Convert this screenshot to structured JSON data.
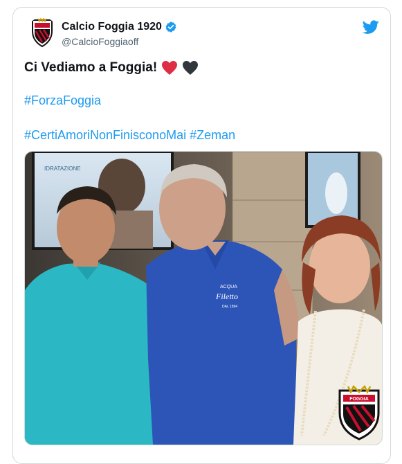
{
  "account": {
    "display_name": "Calcio Foggia 1920",
    "handle": "@CalcioFoggiaoff",
    "verified": true,
    "avatar_icon": "club-crest-icon"
  },
  "tweet": {
    "text": "Ci Vediamo a Foggia!",
    "emojis": [
      "red-heart-icon",
      "black-heart-icon"
    ],
    "hashtags": [
      "#ForzaFoggia",
      "#CertiAmoriNonFinisconoMai",
      "#Zeman"
    ]
  },
  "photo": {
    "background_signs": [
      "IDRATAZIONE"
    ],
    "shirt_text": [
      "ACQUA",
      "Filetto",
      "DAL 1894"
    ],
    "crest_label": "FOGGIA"
  },
  "colors": {
    "link": "#1d9bf0",
    "verified": "#1d9bf0",
    "text": "#0f1419",
    "muted": "#536471",
    "crest_red": "#c8102e",
    "crest_black": "#111111"
  }
}
